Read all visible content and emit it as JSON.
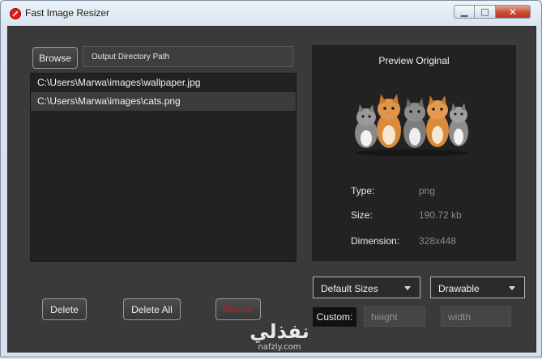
{
  "window": {
    "title": "Fast Image Resizer",
    "controls": {
      "minimize": "▁",
      "maximize": "□",
      "close": "✕"
    }
  },
  "toolbar": {
    "browse_label": "Browse",
    "output_path_placeholder": "Output Directory Path"
  },
  "files": [
    {
      "path": "C:\\Users\\Marwa\\images\\wallpaper.jpg",
      "selected": false
    },
    {
      "path": "C:\\Users\\Marwa\\images\\cats.png",
      "selected": true
    }
  ],
  "preview": {
    "title": "Preview Original",
    "type_label": "Type:",
    "type_value": "png",
    "size_label": "Size:",
    "size_value": "190.72 kb",
    "dimension_label": "Dimension:",
    "dimension_value": "328x448"
  },
  "options": {
    "sizes_selected": "Default Sizes",
    "folder_selected": "Drawable",
    "custom_label": "Custom:",
    "height_placeholder": "height",
    "width_placeholder": "width"
  },
  "actions": {
    "delete_label": "Delete",
    "delete_all_label": "Delete All",
    "resize_label": "Resize"
  },
  "watermark": {
    "main": "نفذلي",
    "sub": "nafzly.com"
  },
  "colors": {
    "panel_bg": "#3a3a3a",
    "list_bg": "#222222",
    "resize_text": "#e01010",
    "close_button": "#c84b32"
  },
  "icons": {
    "app": "red-circle-app-icon",
    "dropdown": "caret-down-icon",
    "preview": "kittens-image"
  }
}
